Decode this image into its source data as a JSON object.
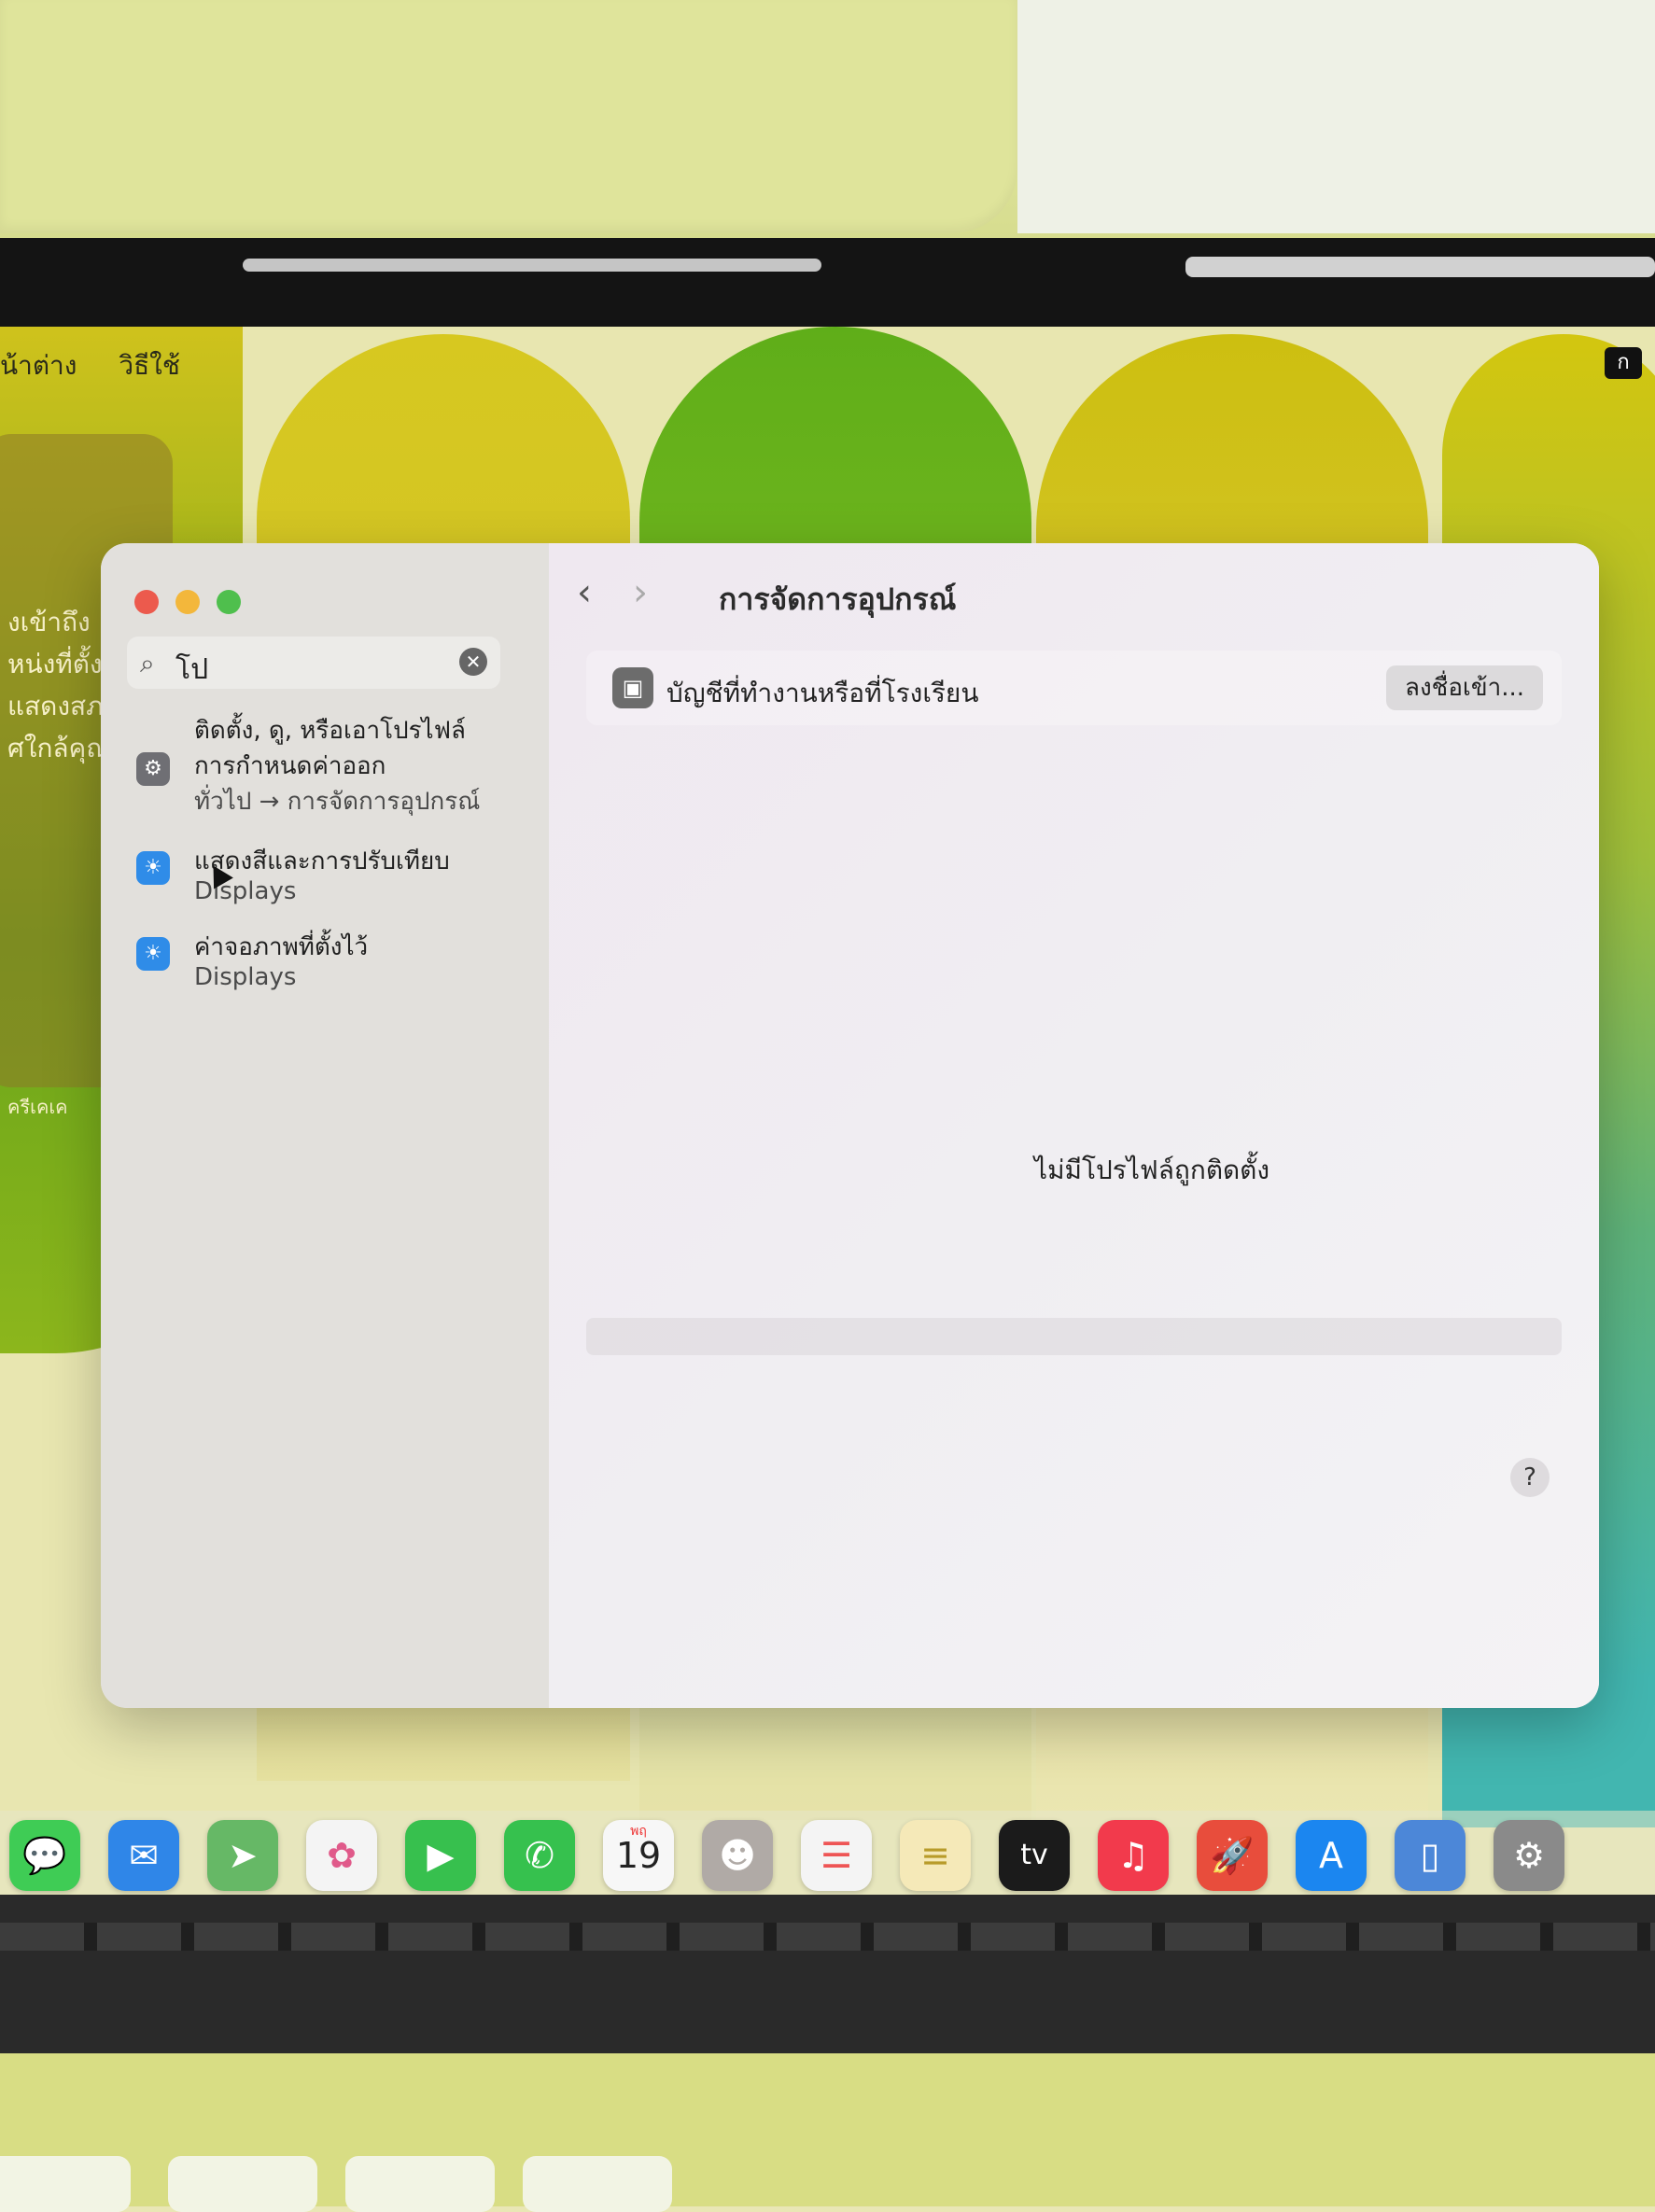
{
  "menubar": {
    "left_items": [
      "น้าต่าง",
      "วิธีใช้"
    ],
    "right_item": "ก"
  },
  "widget": {
    "lines": [
      "งเข้าถึง",
      "หน่งที่ตั้ง",
      "แสดงสภาพ",
      "ศใกล้คุณ",
      "ครีเคเค"
    ]
  },
  "window": {
    "title": "การจัดการอุปกรณ์",
    "nav_back": "‹",
    "nav_forward": "›",
    "search": {
      "value": "โป",
      "icon": "search-icon",
      "clear_icon": "clear-icon"
    },
    "results": [
      {
        "line1": "ติดตั้ง, ดู, หรือเอาโปรไฟล์",
        "line2": "การกำหนดค่าออก",
        "line3": "ทั่วไป → การจัดการอุปกรณ์",
        "icon": "gear-icon",
        "color": "#6f6f74"
      },
      {
        "line1": "แสดงสีและการปรับเทียบ",
        "line2": "Displays",
        "icon": "sun-icon",
        "color": "#2f8ce8"
      },
      {
        "line1": "ค่าจอภาพที่ตั้งไว้",
        "line2": "Displays",
        "icon": "sun-icon",
        "color": "#2f8ce8"
      }
    ],
    "account_row": {
      "label": "บัญชีที่ทำงานหรือที่โรงเรียน",
      "button": "ลงชื่อเข้า..."
    },
    "empty_message": "ไม่มีโปรไฟล์ถูกติดตั้ง",
    "help": "?"
  },
  "dock": {
    "items": [
      {
        "name": "messages",
        "glyph": "💬",
        "color": "#3fcc55"
      },
      {
        "name": "mail",
        "glyph": "✉",
        "color": "#2f86e8"
      },
      {
        "name": "maps",
        "glyph": "➤",
        "color": "#66b866"
      },
      {
        "name": "photos",
        "glyph": "✿",
        "color": "#f4f4f4"
      },
      {
        "name": "facetime",
        "glyph": "▶",
        "color": "#37c04e"
      },
      {
        "name": "phone",
        "glyph": "✆",
        "color": "#36c14e"
      },
      {
        "name": "calendar",
        "glyph": "19",
        "color": "#f7f7f7"
      },
      {
        "name": "contacts",
        "glyph": "☻",
        "color": "#b0aaa6"
      },
      {
        "name": "reminders",
        "glyph": "☰",
        "color": "#f4f4f4"
      },
      {
        "name": "notes",
        "glyph": "≡",
        "color": "#f5e9b8"
      },
      {
        "name": "apple-tv",
        "glyph": "tv",
        "color": "#1b1b1b"
      },
      {
        "name": "music",
        "glyph": "♫",
        "color": "#f23a4c"
      },
      {
        "name": "rocket",
        "glyph": "🚀",
        "color": "#e84d3c"
      },
      {
        "name": "app-store",
        "glyph": "A",
        "color": "#1b86f0"
      },
      {
        "name": "iphone-mirroring",
        "glyph": "▯",
        "color": "#4c87d8"
      },
      {
        "name": "system-settings",
        "glyph": "⚙",
        "color": "#8a8a8a"
      }
    ],
    "calendar_month": "พฤ"
  }
}
